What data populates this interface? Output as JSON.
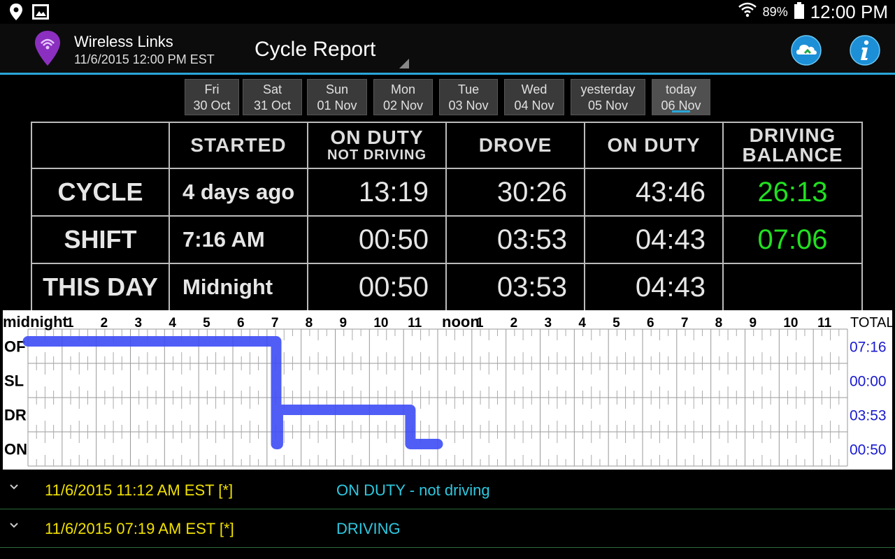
{
  "status_bar": {
    "battery_percent": "89%",
    "clock": "12:00 PM",
    "icons": [
      "location-icon",
      "gallery-icon",
      "wifi-icon",
      "battery-icon"
    ]
  },
  "action_bar": {
    "app_name": "Wireless Links",
    "datetime": "11/6/2015 12:00 PM EST",
    "title": "Cycle Report",
    "accent_color": "#2aa6d8"
  },
  "day_tabs": [
    {
      "day": "Fri",
      "date": "30 Oct",
      "selected": false
    },
    {
      "day": "Sat",
      "date": "31 Oct",
      "selected": false
    },
    {
      "day": "Sun",
      "date": "01 Nov",
      "selected": false
    },
    {
      "day": "Mon",
      "date": "02 Nov",
      "selected": false
    },
    {
      "day": "Tue",
      "date": "03 Nov",
      "selected": false
    },
    {
      "day": "Wed",
      "date": "04 Nov",
      "selected": false
    },
    {
      "day": "yesterday",
      "date": "05 Nov",
      "selected": false
    },
    {
      "day": "today",
      "date": "06 Nov",
      "selected": true
    }
  ],
  "summary": {
    "headers": {
      "started": "STARTED",
      "on_duty_nd": "ON DUTY",
      "on_duty_nd_sub": "NOT DRIVING",
      "drove": "DROVE",
      "on_duty": "ON DUTY",
      "balance": "DRIVING",
      "balance_sub": "BALANCE"
    },
    "rows": [
      {
        "label": "CYCLE",
        "started": "4 days ago",
        "on_duty_nd": "13:19",
        "drove": "30:26",
        "on_duty": "43:46",
        "balance": "26:13"
      },
      {
        "label": "SHIFT",
        "started": "7:16 AM",
        "on_duty_nd": "00:50",
        "drove": "03:53",
        "on_duty": "04:43",
        "balance": "07:06"
      },
      {
        "label": "THIS DAY",
        "started": "Midnight",
        "on_duty_nd": "00:50",
        "drove": "03:53",
        "on_duty": "04:43",
        "balance": ""
      }
    ],
    "balance_color": "#21e021"
  },
  "log_grid": {
    "hour_labels": [
      "midnight",
      "1",
      "2",
      "3",
      "4",
      "5",
      "6",
      "7",
      "8",
      "9",
      "10",
      "11",
      "noon",
      "1",
      "2",
      "3",
      "4",
      "5",
      "6",
      "7",
      "8",
      "9",
      "10",
      "11"
    ],
    "total_label": "TOTAL",
    "status_rows": [
      {
        "code": "OF",
        "total": "07:16"
      },
      {
        "code": "SL",
        "total": "00:00"
      },
      {
        "code": "DR",
        "total": "03:53"
      },
      {
        "code": "ON",
        "total": "00:50"
      }
    ],
    "segments": [
      {
        "status": "OF",
        "start_hour": 0.0,
        "end_hour": 7.27
      },
      {
        "status": "ON",
        "start_hour": 7.27,
        "end_hour": 7.32
      },
      {
        "status": "DR",
        "start_hour": 7.32,
        "end_hour": 11.2
      },
      {
        "status": "ON",
        "start_hour": 11.2,
        "end_hour": 12.0
      }
    ],
    "line_color": "#3d4df5",
    "total_color": "#1a1ad0"
  },
  "events": [
    {
      "time": "11/6/2015 11:12 AM EST [*]",
      "status": "ON DUTY - not driving"
    },
    {
      "time": "11/6/2015 07:19 AM EST [*]",
      "status": "DRIVING"
    }
  ]
}
